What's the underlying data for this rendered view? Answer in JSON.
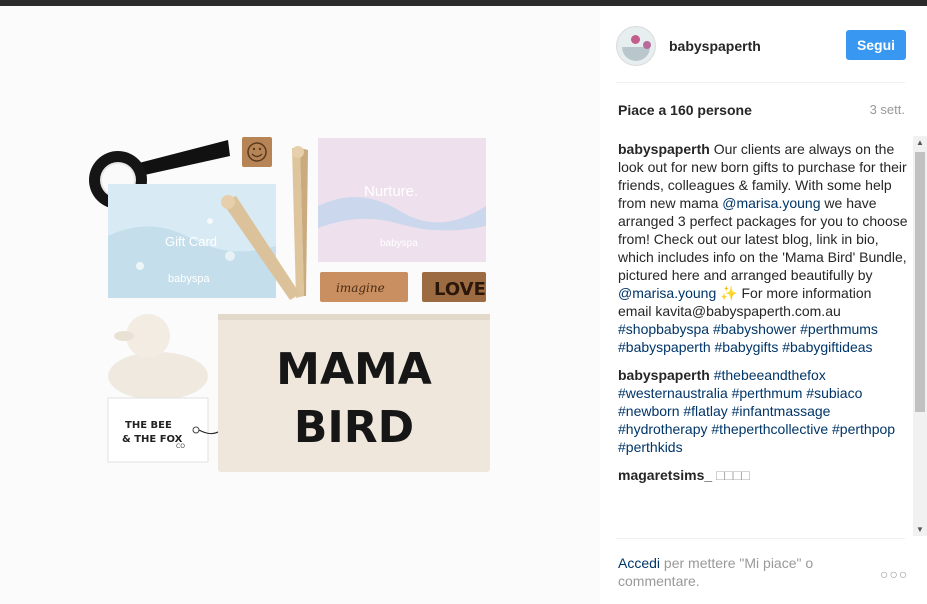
{
  "post": {
    "username": "babyspaperth",
    "follow_label": "Segui",
    "likes": "Piace a 160 persone",
    "time": "3 sett."
  },
  "photo": {
    "gift_card_text": "Gift Card",
    "gift_card_brand": "babyspa",
    "nurture_text": "Nurture.",
    "nurture_brand": "babyspa",
    "block_imagine": "imagine",
    "block_love": "LOVE",
    "shirt_line1": "MAMA",
    "shirt_line2": "BIRD",
    "tag_line1": "THE BEE",
    "tag_line2": "& THE FOX",
    "tag_small": "CO"
  },
  "caption": {
    "user": "babyspaperth",
    "text1": "Our clients are always on the look out for new born gifts to purchase for their friends, colleagues & family. With some help from new mama ",
    "mention1": "@marisa.young",
    "text2": " we have arranged 3 perfect packages for you to choose from! Check out our latest blog, link in bio, which includes info on the 'Mama Bird' Bundle, pictured here and arranged beautifully by ",
    "mention2": "@marisa.young",
    "text3": " ✨ For more information email kavita@babyspaperth.com.au",
    "tags": "#shopbabyspa #babyshower #perthmums #babyspaperth #babygifts #babygiftideas"
  },
  "comments": [
    {
      "user": "babyspaperth",
      "tags": "#thebeeandthefox #westernaustralia #perthmum #subiaco #newborn #flatlay #infantmassage #hydrotherapy #theperthcollective #perthpop #perthkids"
    },
    {
      "user": "magaretsims_",
      "text": "□□□□"
    }
  ],
  "footer": {
    "login_link": "Accedi",
    "login_text": " per mettere \"Mi piace\" o commentare.",
    "more": "○○○"
  },
  "icons": [
    "avatar",
    "scroll-up-icon",
    "scroll-down-icon",
    "more-options-icon"
  ],
  "colors": {
    "follow_button": "#3897f0",
    "link": "#003569",
    "muted": "#999999"
  }
}
